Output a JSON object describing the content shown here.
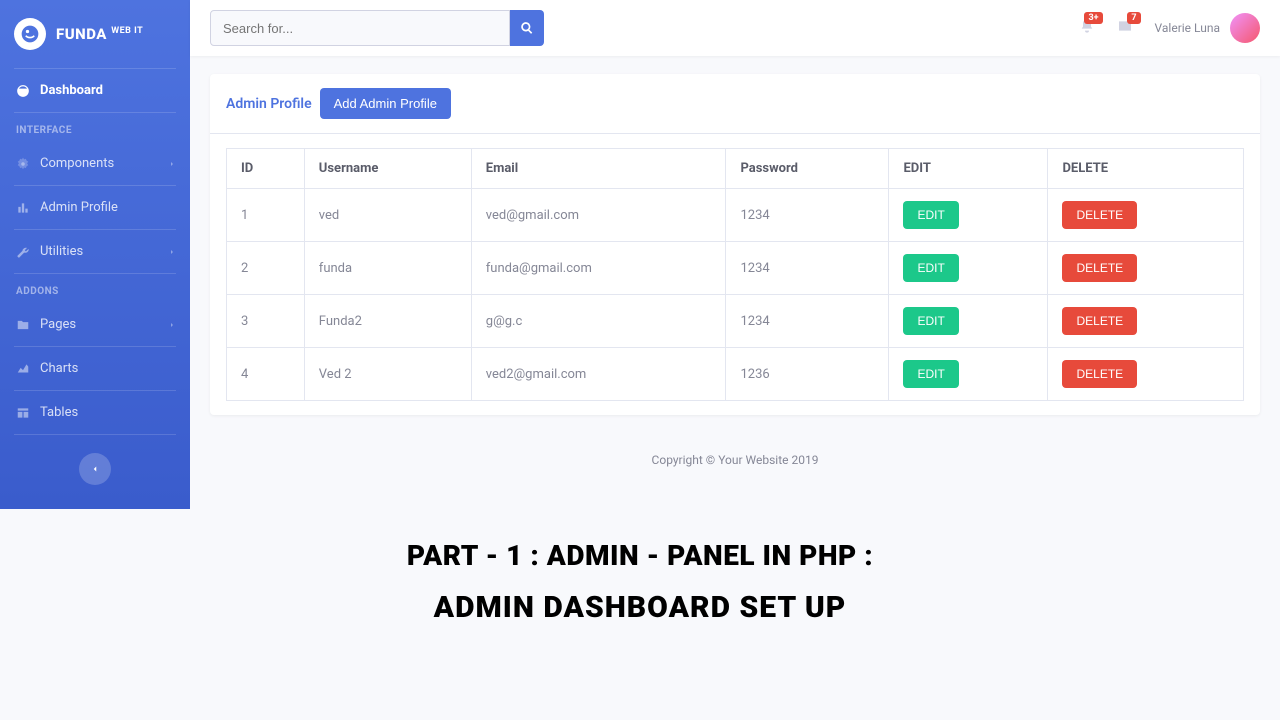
{
  "brand": {
    "name": "FUNDA",
    "sup": "WEB IT"
  },
  "sidebar": {
    "dashboard": "Dashboard",
    "heading1": "INTERFACE",
    "components": "Components",
    "adminProfile": "Admin Profile",
    "utilities": "Utilities",
    "heading2": "ADDONS",
    "pages": "Pages",
    "charts": "Charts",
    "tables": "Tables"
  },
  "topbar": {
    "searchPlaceholder": "Search for...",
    "bellBadge": "3+",
    "mailBadge": "7",
    "userName": "Valerie Luna"
  },
  "card": {
    "title": "Admin Profile",
    "addBtn": "Add Admin Profile"
  },
  "table": {
    "headers": [
      "ID",
      "Username",
      "Email",
      "Password",
      "EDIT",
      "DELETE"
    ],
    "rows": [
      {
        "id": "1",
        "user": "ved",
        "email": "ved@gmail.com",
        "pass": "1234"
      },
      {
        "id": "2",
        "user": "funda",
        "email": "funda@gmail.com",
        "pass": "1234"
      },
      {
        "id": "3",
        "user": "Funda2",
        "email": "g@g.c",
        "pass": "1234"
      },
      {
        "id": "4",
        "user": "Ved 2",
        "email": "ved2@gmail.com",
        "pass": "1236"
      }
    ],
    "editLabel": "EDIT",
    "deleteLabel": "DELETE"
  },
  "footer": "Copyright © Your Website 2019",
  "caption": {
    "line1": "PART - 1 :   ADMIN - PANEL IN PHP :",
    "line2": "ADMIN DASHBOARD SET UP"
  }
}
